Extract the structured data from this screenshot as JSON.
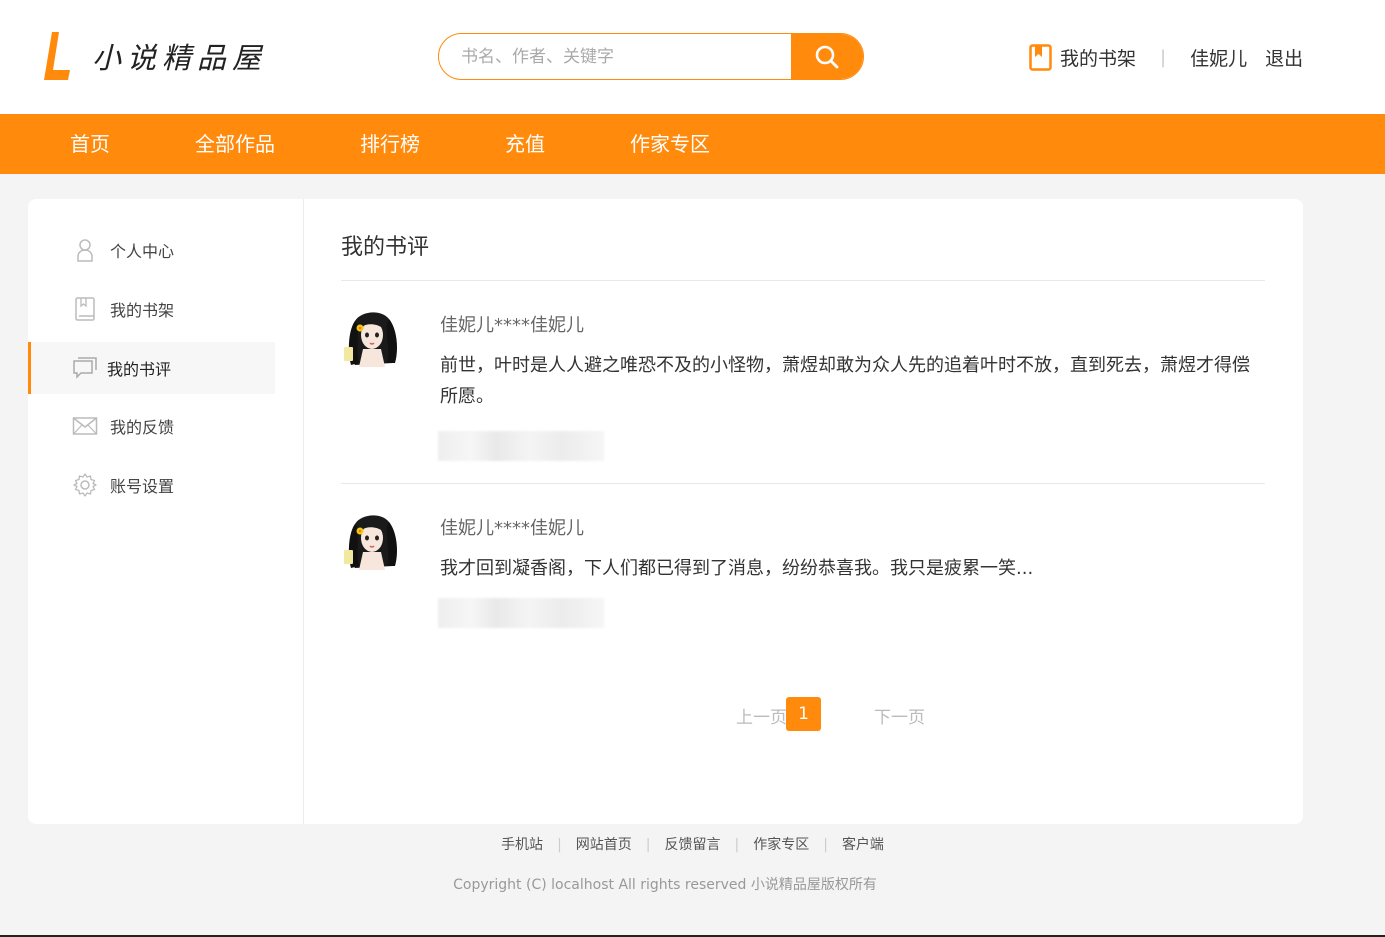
{
  "brand": {
    "name": "小说精品屋",
    "accent": "#ff8a0c"
  },
  "search": {
    "placeholder": "书名、作者、关键字",
    "icon": "search-icon"
  },
  "header": {
    "shelf_label": "我的书架",
    "separator": "|",
    "username": "佳妮儿",
    "logout_label": "退出"
  },
  "nav": {
    "items": [
      "首页",
      "全部作品",
      "排行榜",
      "充值",
      "作家专区"
    ]
  },
  "sidebar": {
    "items": [
      {
        "label": "个人中心",
        "icon": "user-icon",
        "active": false
      },
      {
        "label": "我的书架",
        "icon": "book-icon",
        "active": false
      },
      {
        "label": "我的书评",
        "icon": "comment-icon",
        "active": true
      },
      {
        "label": "我的反馈",
        "icon": "mail-icon",
        "active": false
      },
      {
        "label": "账号设置",
        "icon": "gear-icon",
        "active": false
      }
    ]
  },
  "content": {
    "title": "我的书评",
    "reviews": [
      {
        "user": "佳妮儿****佳妮儿",
        "text": "前世，叶时是人人避之唯恐不及的小怪物，萧煜却敢为众人先的追着叶时不放，直到死去，萧煜才得偿所愿。"
      },
      {
        "user": "佳妮儿****佳妮儿",
        "text": "我才回到凝香阁，下人们都已得到了消息，纷纷恭喜我。我只是疲累一笑..."
      }
    ]
  },
  "pager": {
    "prev": "上一页",
    "current": "1",
    "next": "下一页"
  },
  "footer": {
    "links": [
      "手机站",
      "网站首页",
      "反馈留言",
      "作家专区",
      "客户端"
    ],
    "copyright": "Copyright (C) localhost All rights reserved 小说精品屋版权所有"
  }
}
